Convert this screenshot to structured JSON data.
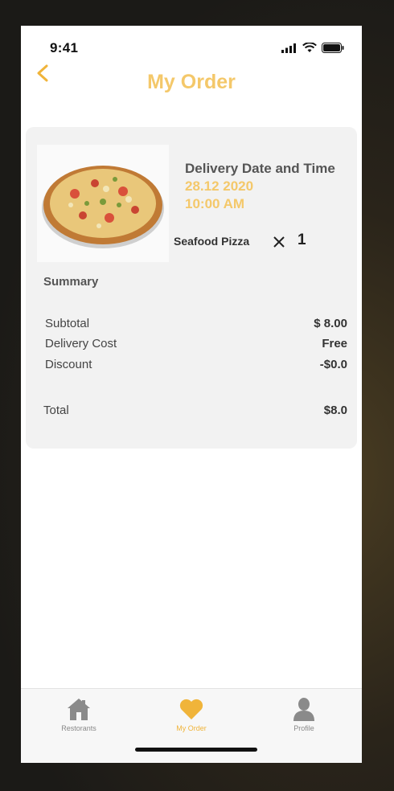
{
  "status_bar": {
    "time": "9:41"
  },
  "header": {
    "title": "My Order"
  },
  "order": {
    "delivery_label": "Delivery Date and Time",
    "delivery_date": "28.12 2020",
    "delivery_time": "10:00 AM",
    "item_name": "Seafood Pizza",
    "quantity": "1"
  },
  "summary": {
    "heading": "Summary",
    "rows": [
      {
        "label": "Subtotal",
        "value": "$ 8.00"
      },
      {
        "label": "Delivery Cost",
        "value": "Free"
      },
      {
        "label": "Discount",
        "value": "-$0.0"
      }
    ],
    "total_label": "Total",
    "total_value": "$8.0"
  },
  "tabs": [
    {
      "label": "Restorants",
      "icon": "home-icon"
    },
    {
      "label": "My Order",
      "icon": "heart-icon",
      "active": true
    },
    {
      "label": "Profile",
      "icon": "profile-icon"
    }
  ],
  "colors": {
    "accent": "#f4c86a",
    "active_tab": "#f0b43a"
  }
}
